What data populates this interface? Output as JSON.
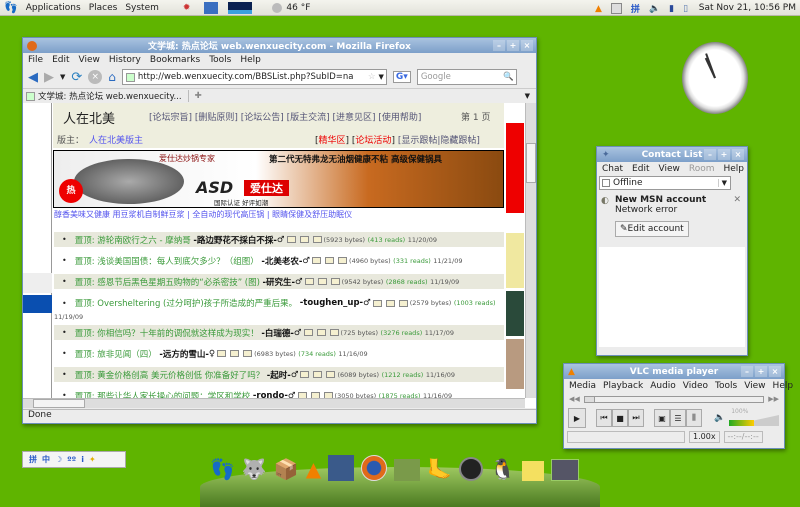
{
  "panel": {
    "menus": [
      "Applications",
      "Places",
      "System"
    ],
    "weather": "46 °F",
    "clock": "Sat Nov 21, 10:56 PM",
    "ime": "拼"
  },
  "firefox": {
    "title": "文学城: 热点论坛 web.wenxuecity.com - Mozilla Firefox",
    "menu": [
      "File",
      "Edit",
      "View",
      "History",
      "Bookmarks",
      "Tools",
      "Help"
    ],
    "url": "http://web.wenxuecity.com/BBSList.php?SubID=na",
    "search_placeholder": "Google",
    "tab": "文学城: 热点论坛 web.wenxuecity...",
    "status": "Done",
    "page": {
      "forum": "人在北美",
      "links": "[论坛宗旨] [删贴原则] [论坛公告] [版主交流] [进意见区] [使用帮助]",
      "page_no": "第 1 页",
      "moderator_label": "版主：",
      "moderator": "人在北美版主",
      "featured": "精华区",
      "activity": "论坛活动",
      "show_hide": "[显示跟帖|隐藏跟帖]",
      "banner": {
        "top": "爱仕达炒锅专家",
        "headline": "第二代无特弗龙无油烟健康不粘 高级保健锅具",
        "brand": "ASD",
        "brand_cn": "爱仕达",
        "slogan": "国际认证 好评如潮",
        "hot": "热"
      },
      "ad_links": "醇香美味又健康 用豆浆机自制鲜豆浆 | 全自动的现代高压锅 | 眼睛保健及舒压助眠仪",
      "posts": [
        {
          "title": "置顶: 游轮南欧行之六 - 摩纳哥",
          "author": "-路边野花不採白不採-",
          "gender": "♂",
          "bytes": "(5923 bytes)",
          "reads": "(413 reads)",
          "date": "11/20/09"
        },
        {
          "title": "置顶: 浅谈美国国债：每人到底欠多少？（组图）",
          "author": "-北美老农-",
          "gender": "♂",
          "bytes": "(4960 bytes)",
          "reads": "(331 reads)",
          "date": "11/21/09"
        },
        {
          "title": "置顶: 感恩节后黑色星期五购物的“必杀密技” (图)",
          "author": "-研究生-",
          "gender": "♂",
          "bytes": "(9542 bytes)",
          "reads": "(2868 reads)",
          "date": "11/19/09"
        },
        {
          "title": "置顶: Oversheltering (过分呵护)孩子所造成的严重后果。",
          "author": "-toughen_up-",
          "gender": "♂",
          "bytes": "(2579 bytes)",
          "reads": "(1003 reads)",
          "date": "11/19/09"
        },
        {
          "title": "置顶: 你相信吗？十年前的调侃就这样成为现实！",
          "author": "-白瑞德-",
          "gender": "♂",
          "bytes": "(725 bytes)",
          "reads": "(3276 reads)",
          "date": "11/17/09"
        },
        {
          "title": "置顶: 旅非见闻（四）",
          "author": "-远方的雪山-",
          "gender": "♀",
          "bytes": "(6983 bytes)",
          "reads": "(734 reads)",
          "date": "11/16/09"
        },
        {
          "title": "置顶: 黄金价格创高 美元价格创低 你准备好了吗？",
          "author": "-起时-",
          "gender": "♂",
          "bytes": "(6089 bytes)",
          "reads": "(1212 reads)",
          "date": "11/16/09"
        },
        {
          "title": "置顶: 那些让华人家长操心的问题：学区和学校",
          "author": "-rondo-",
          "gender": "♂",
          "bytes": "(3050 bytes)",
          "reads": "(1875 reads)",
          "date": "11/16/09"
        }
      ]
    }
  },
  "contacts": {
    "title": "Contact List",
    "menu": [
      "Chat",
      "Edit",
      "View",
      "Room",
      "Help"
    ],
    "status": "Offline",
    "account": "New MSN account",
    "error": "Network error",
    "edit": "Edit account"
  },
  "vlc": {
    "title": "VLC media player",
    "menu": [
      "Media",
      "Playback",
      "Audio",
      "Video",
      "Tools",
      "View",
      "Help"
    ],
    "volume": "100%",
    "speed": "1.00x",
    "time": "--:--/--:--"
  }
}
